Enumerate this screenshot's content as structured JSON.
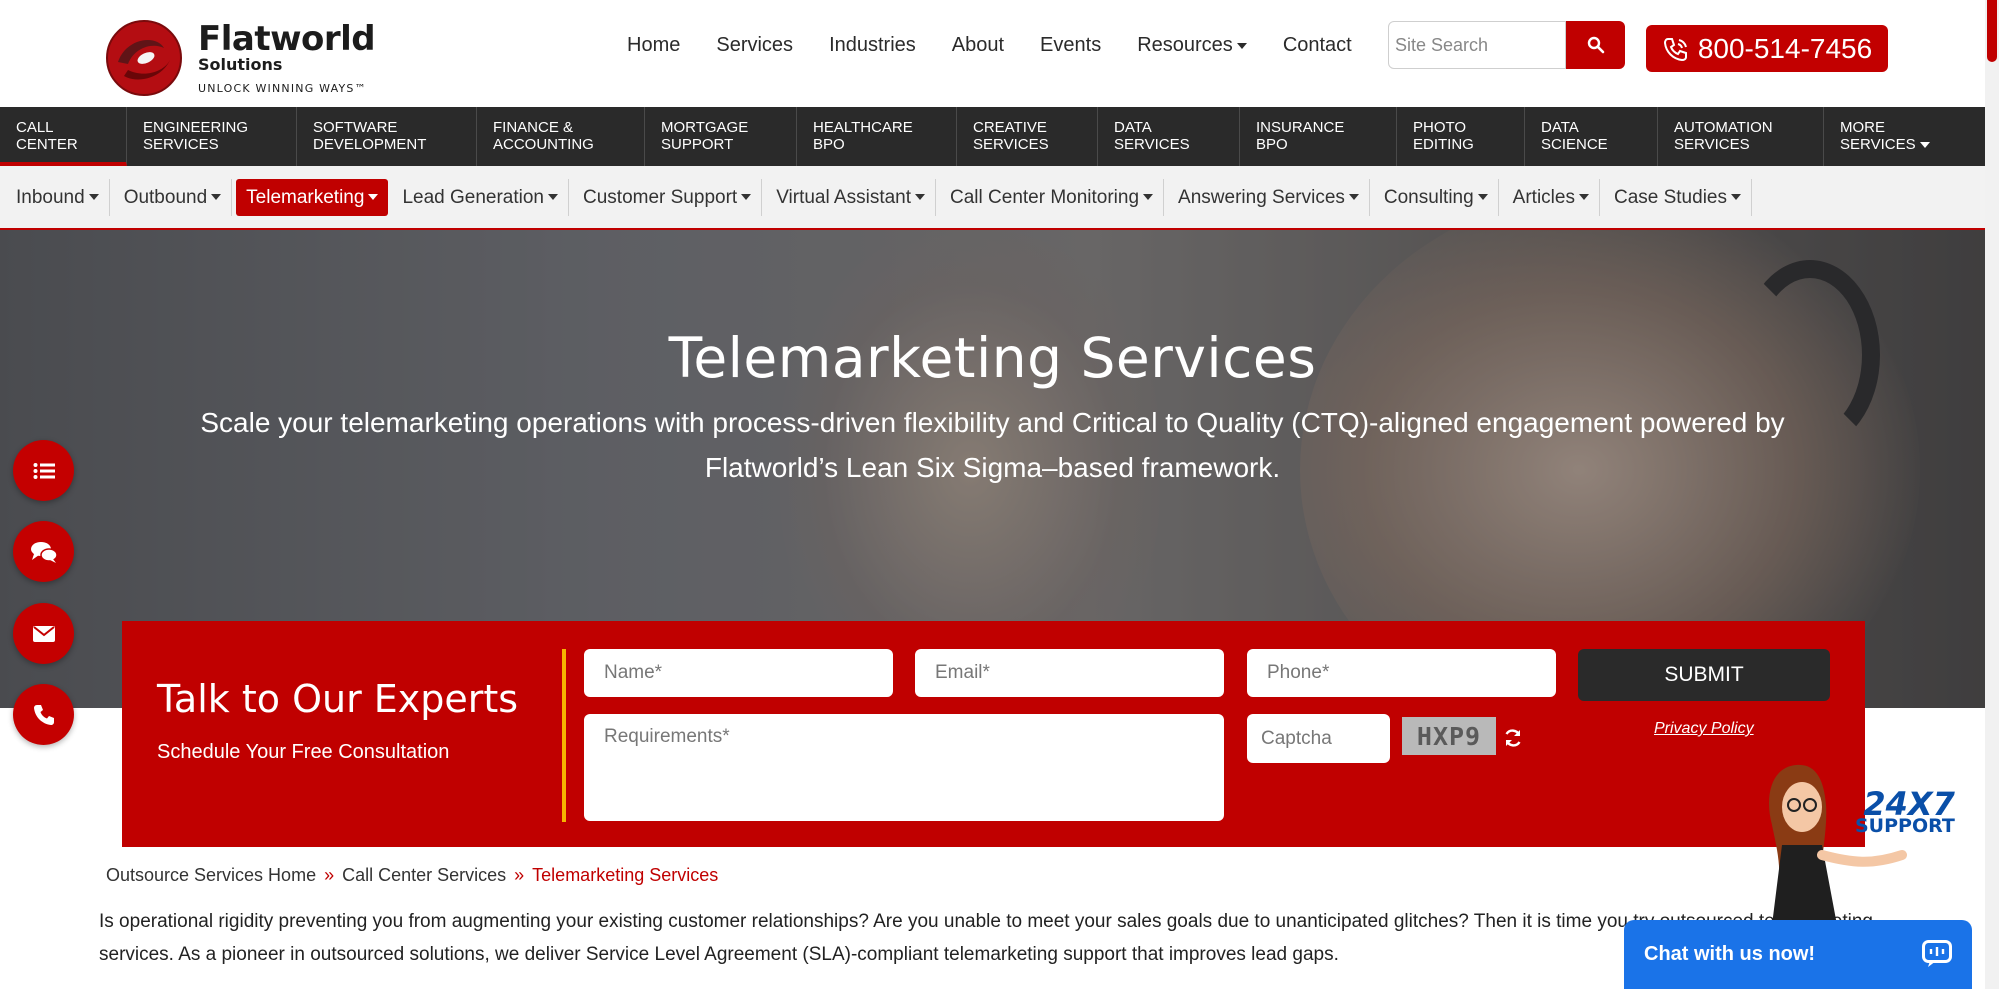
{
  "brand": {
    "name": "Flatworld",
    "sub": "Solutions",
    "tagline": "UNLOCK WINNING WAYS",
    "tm": "™"
  },
  "topnav": [
    {
      "label": "Home"
    },
    {
      "label": "Services"
    },
    {
      "label": "Industries"
    },
    {
      "label": "About"
    },
    {
      "label": "Events"
    },
    {
      "label": "Resources",
      "dropdown": true
    },
    {
      "label": "Contact"
    }
  ],
  "search": {
    "placeholder": "Site Search",
    "icon": "search-icon"
  },
  "phone": {
    "number": "800-514-7456",
    "icon": "phone-volume-icon"
  },
  "services": [
    {
      "l1": "CALL",
      "l2": "CENTER",
      "active": true
    },
    {
      "l1": "ENGINEERING",
      "l2": "SERVICES"
    },
    {
      "l1": "SOFTWARE",
      "l2": "DEVELOPMENT"
    },
    {
      "l1": "FINANCE &",
      "l2": "ACCOUNTING"
    },
    {
      "l1": "MORTGAGE",
      "l2": "SUPPORT"
    },
    {
      "l1": "HEALTHCARE",
      "l2": "BPO"
    },
    {
      "l1": "CREATIVE",
      "l2": "SERVICES"
    },
    {
      "l1": "DATA",
      "l2": "SERVICES"
    },
    {
      "l1": "INSURANCE",
      "l2": "BPO"
    },
    {
      "l1": "PHOTO",
      "l2": "EDITING"
    },
    {
      "l1": "DATA",
      "l2": "SCIENCE"
    },
    {
      "l1": "AUTOMATION",
      "l2": "SERVICES"
    },
    {
      "l1": "MORE",
      "l2": "SERVICES"
    }
  ],
  "subnav": [
    {
      "label": "Inbound"
    },
    {
      "label": "Outbound"
    },
    {
      "label": "Telemarketing",
      "active": true
    },
    {
      "label": "Lead Generation"
    },
    {
      "label": "Customer Support"
    },
    {
      "label": "Virtual Assistant"
    },
    {
      "label": "Call Center Monitoring"
    },
    {
      "label": "Answering Services"
    },
    {
      "label": "Consulting"
    },
    {
      "label": "Articles"
    },
    {
      "label": "Case Studies"
    }
  ],
  "hero": {
    "title": "Telemarketing Services",
    "subtitle": "Scale your telemarketing operations with process-driven flexibility and Critical to Quality (CTQ)-aligned engagement powered by Flatworld’s Lean Six Sigma–based framework."
  },
  "floating_icons": [
    "list-icon",
    "chat-bubbles-icon",
    "envelope-icon",
    "phone-icon"
  ],
  "form": {
    "title": "Talk to Our Experts",
    "subtitle": "Schedule Your Free Consultation",
    "name_placeholder": "Name*",
    "email_placeholder": "Email*",
    "phone_placeholder": "Phone*",
    "requirements_placeholder": "Requirements*",
    "captcha_placeholder": "Captcha",
    "captcha_code": "HXP9",
    "submit_label": "SUBMIT",
    "privacy_label": "Privacy Policy"
  },
  "breadcrumb": {
    "items": [
      "Outsource Services Home",
      "Call Center Services"
    ],
    "current": "Telemarketing Services",
    "separator": "»"
  },
  "body": {
    "paragraph": "Is operational rigidity preventing you from augmenting your existing customer relationships? Are you unable to meet your sales goals due to unanticipated glitches? Then it is time you try outsourced telemarketing services. As a pioneer in outsourced solutions, we deliver Service Level Agreement (SLA)-compliant telemarketing support that improves lead gaps."
  },
  "support": {
    "big": "24X7",
    "small": "SUPPORT",
    "chat_label": "Chat with us now!"
  },
  "colors": {
    "brand_red": "#c00000",
    "dark_bar": "#2a2a2a",
    "chat_blue": "#1a73e8",
    "accent_yellow": "#f6b400"
  }
}
